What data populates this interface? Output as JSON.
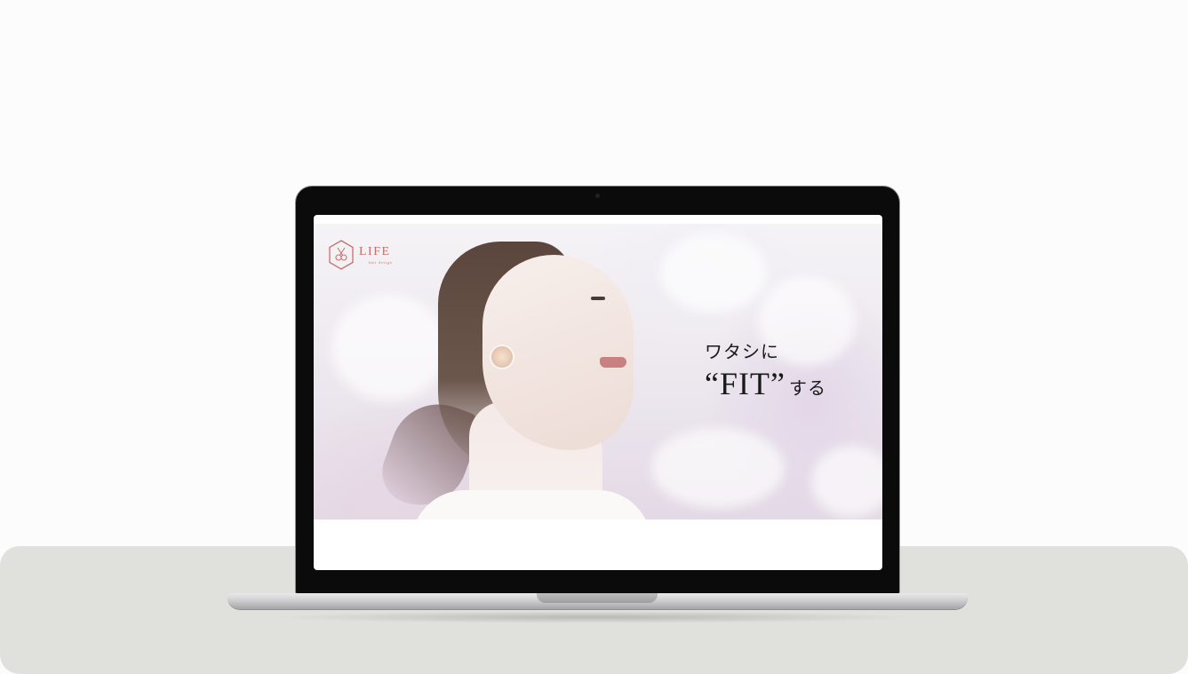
{
  "site": {
    "logo": {
      "name": "LIFE",
      "sub": "hair design"
    },
    "hero": {
      "line1": "ワタシに",
      "fit": "“FIT”",
      "suffix": "する"
    }
  },
  "colors": {
    "background": "#fcfcfc",
    "table": "#e0e1dc",
    "bezel": "#0b0b0b",
    "logo_accent": "#c76d6d",
    "tagline": "#1a1a1a"
  },
  "icons": {
    "logo_badge": "hexagon-scissors-icon"
  }
}
